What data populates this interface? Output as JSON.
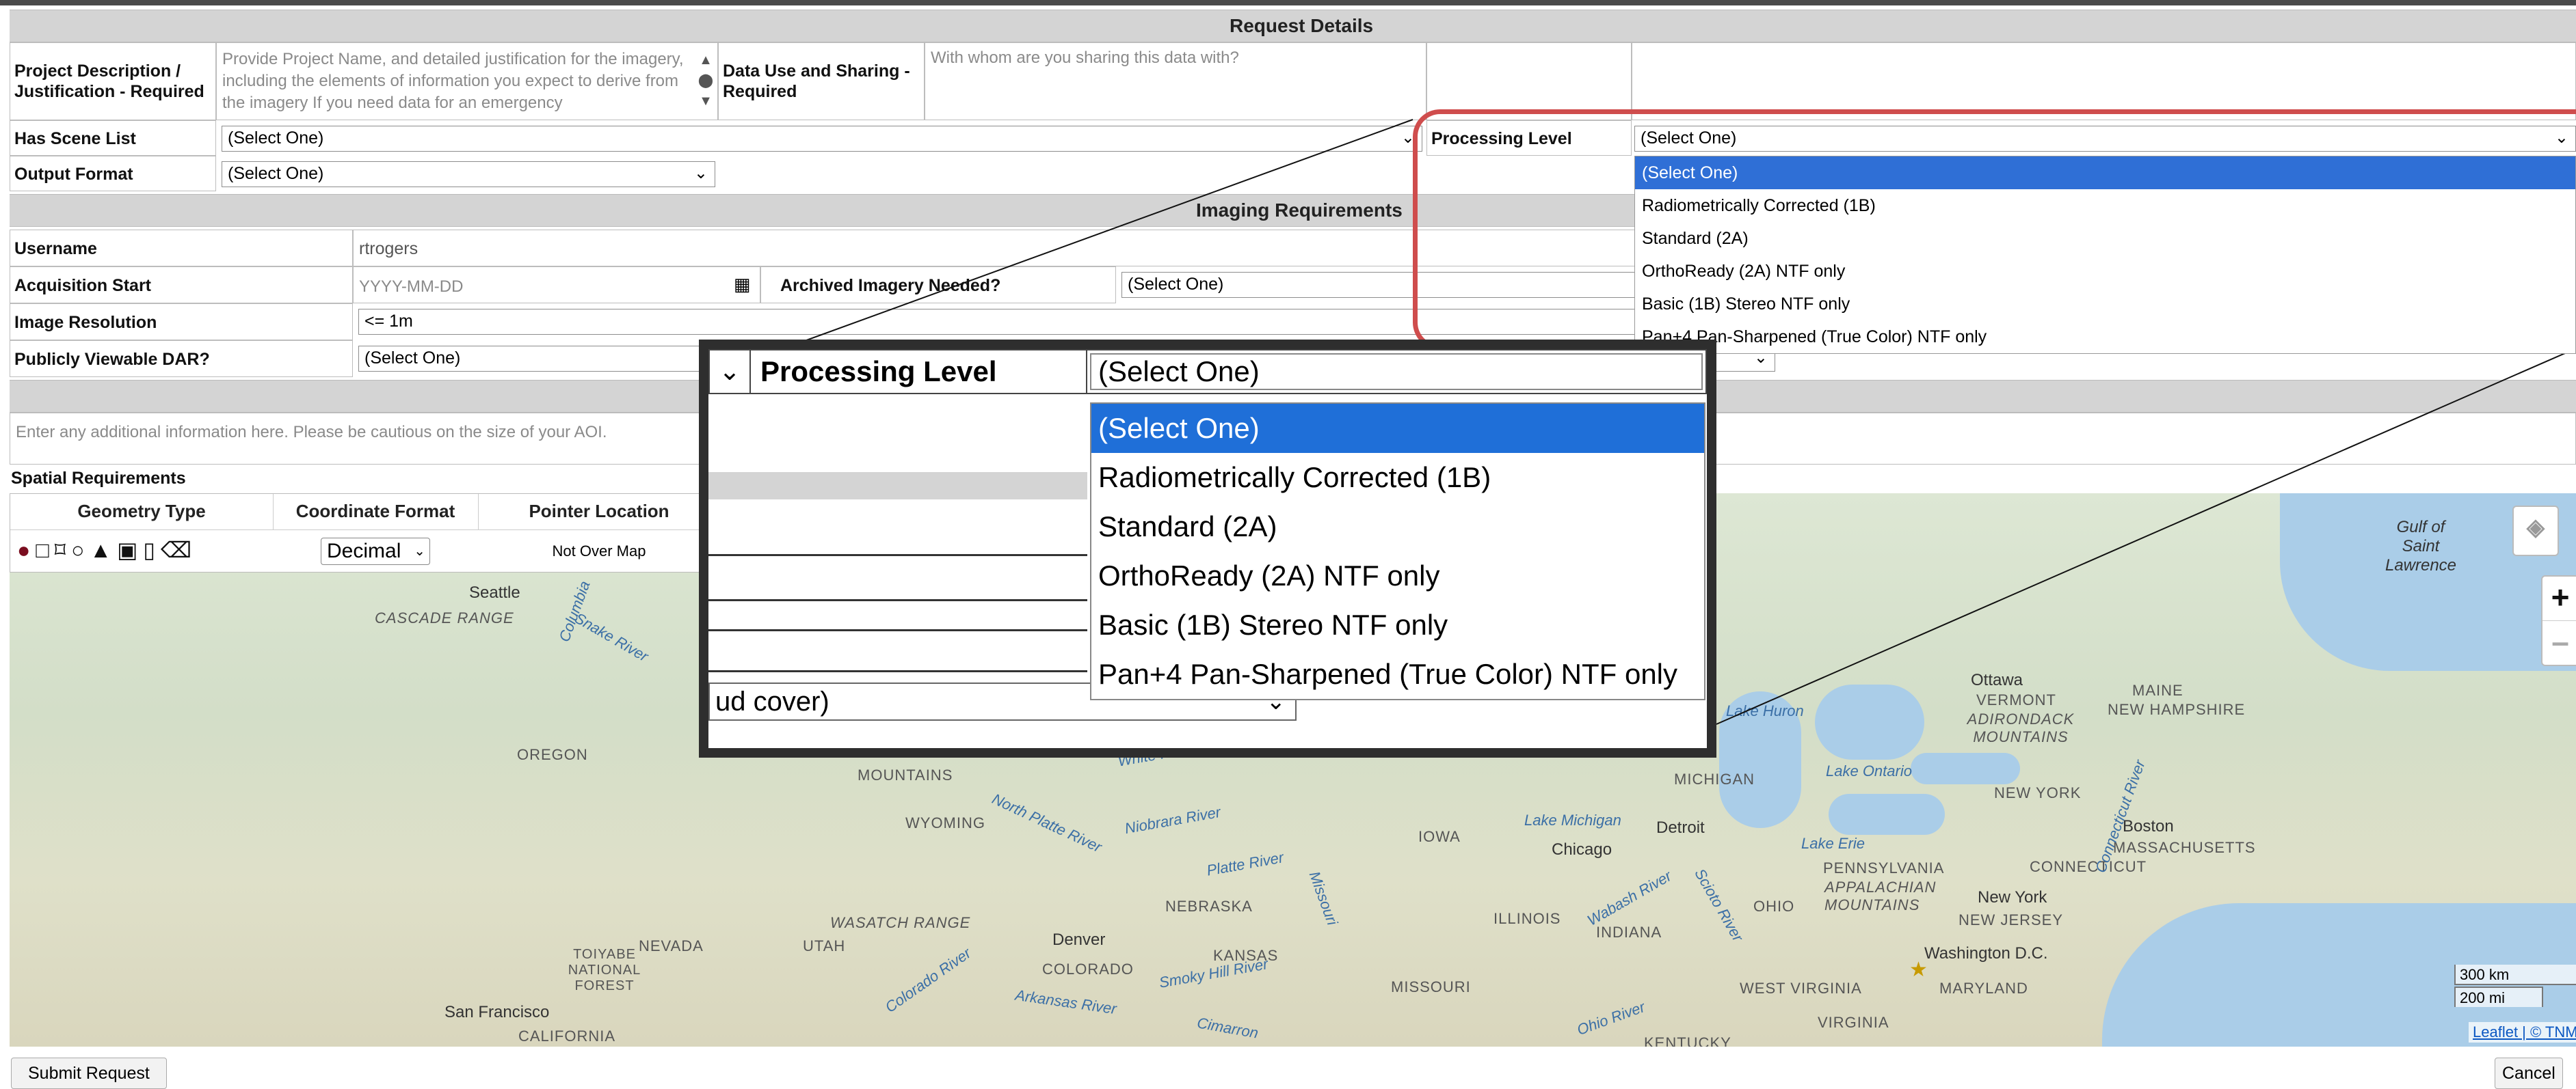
{
  "request_details": {
    "header": "Request Details",
    "project_description_label": "Project Description / Justification - Required",
    "project_description_placeholder": "Provide Project Name, and detailed justification for the imagery, including the elements of information you expect to derive from the imagery  If you need data for an emergency",
    "data_use_label": "Data Use and Sharing - Required",
    "data_use_placeholder": "With whom are you sharing this data with?",
    "has_scene_list_label": "Has Scene List",
    "has_scene_list_value": "(Select One)",
    "output_format_label": "Output Format",
    "output_format_value": "(Select One)",
    "processing_level_label": "Processing Level",
    "processing_level_value": "(Select One)",
    "processing_level_options": [
      "(Select One)",
      "Radiometrically Corrected (1B)",
      "Standard (2A)",
      "OrthoReady (2A) NTF only",
      "Basic (1B) Stereo NTF only",
      "Pan+4 Pan-Sharpened (True Color) NTF only"
    ]
  },
  "imaging_requirements": {
    "header": "Imaging Requirements",
    "username_label": "Username",
    "username_value": "rtrogers",
    "acquisition_start_label": "Acquisition Start",
    "acquisition_start_placeholder": "YYYY-MM-DD",
    "archived_label": "Archived Imagery Needed?",
    "archived_value": "(Select One)",
    "image_resolution_label": "Image Resolution",
    "image_resolution_value": "<= 1m",
    "publicly_viewable_label": "Publicly Viewable DAR?",
    "publicly_viewable_value": "(Select One)"
  },
  "additional_info_placeholder": "Enter any additional information here. Please be cautious on the size of your AOI.",
  "spatial": {
    "title": "Spatial Requirements",
    "col_geometry": "Geometry Type",
    "col_coordinate": "Coordinate Format",
    "col_pointer": "Pointer Location",
    "coordinate_value": "Decimal",
    "pointer_value": "Not Over Map"
  },
  "map": {
    "labels": [
      "Seattle",
      "CASCADE RANGE",
      "OREGON",
      "WYOMING",
      "MOUNTAINS",
      "NEBRASKA",
      "KANSAS",
      "IOWA",
      "ILLINOIS",
      "INDIANA",
      "OHIO",
      "MISSOURI",
      "COLORADO",
      "UTAH",
      "NEVADA",
      "Denver",
      "WASATCH RANGE",
      "TOIYABE NATIONAL FOREST",
      "San Francisco",
      "CALIFORNIA",
      "Chicago",
      "Detroit",
      "MICHIGAN",
      "Ottawa",
      "VERMONT",
      "MAINE",
      "NEW HAMPSHIRE",
      "ADIRONDACK MOUNTAINS",
      "NEW YORK",
      "Boston",
      "MASSACHUSETTS",
      "CONNECTICUT",
      "New York",
      "PENNSYLVANIA",
      "APPALACHIAN MOUNTAINS",
      "NEW JERSEY",
      "Washington D.C.",
      "MARYLAND",
      "WEST VIRGINIA",
      "VIRGINIA",
      "KENTUCKY",
      "Gulf of Saint Lawrence",
      "Lake Huron",
      "Lake Ontario",
      "Lake Michigan",
      "Lake Erie"
    ],
    "rivers": [
      "Snake River",
      "Columbia",
      "North Platte River",
      "Niobrara River",
      "Platte River",
      "Smoky Hill River",
      "Arkansas River",
      "Colorado River",
      "Missouri",
      "Wabash River",
      "Ohio River",
      "Scioto River",
      "White River",
      "Connecticut River",
      "Cimarron"
    ],
    "scale_km": "300 km",
    "scale_mi": "200 mi",
    "attribution": "Leaflet | © TNM",
    "zoom_in": "+",
    "zoom_out": "–"
  },
  "callout": {
    "label": "Processing Level",
    "value": "(Select One)",
    "left_chevron": "❯",
    "row_text": "ud cover)"
  },
  "buttons": {
    "submit": "Submit Request",
    "cancel": "Cancel"
  }
}
